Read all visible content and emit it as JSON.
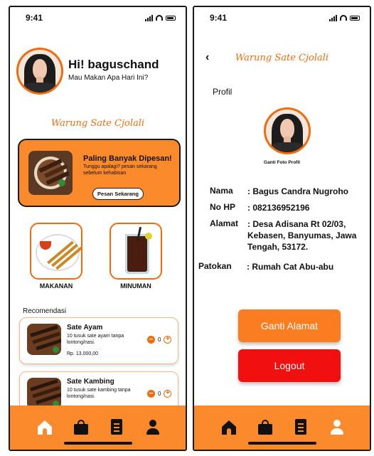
{
  "status_bar": {
    "time": "9:41"
  },
  "home": {
    "greeting_title": "Hi! baguschand",
    "greeting_subtitle": "Mau Makan Apa Hari Ini?",
    "brand": "Warung Sate Cjolali",
    "promo": {
      "title": "Paling Banyak Dipesan!",
      "description": "Tunggu apalagi? pesan sekarang sebelum kehabisan",
      "button": "Pesan Sekarang"
    },
    "categories": [
      {
        "label": "MAKANAN",
        "icon": "satay-food-image"
      },
      {
        "label": "MINUMAN",
        "icon": "iced-drink-image"
      }
    ],
    "recommendation_title": "Recomendasi",
    "items": [
      {
        "name": "Sate Ayam",
        "description": "10 tusuk sate ayam tanpa lontong/nasi.",
        "price": "Rp. 13.000,00",
        "qty": "0"
      },
      {
        "name": "Sate Kambing",
        "description": "10 tusuk sate kambing tanpa lontong/nasi.",
        "price": "",
        "qty": "0"
      }
    ]
  },
  "profile": {
    "back": "‹",
    "brand": "Warung Sate Cjolali",
    "section_title": "Profil",
    "change_photo": "Ganti Foto Profil",
    "fields": {
      "nama": {
        "label": "Nama",
        "value": ": Bagus Candra Nugroho"
      },
      "nohp": {
        "label": "No HP",
        "value": ": 082136952196"
      },
      "alamat": {
        "label": "Alamat",
        "value": ": Desa Adisana Rt 02/03, Kebasen, Banyumas, Jawa Tengah, 53172."
      },
      "patokan": {
        "label": "Patokan",
        "value": ": Rumah Cat Abu-abu"
      }
    },
    "buttons": {
      "change_address": "Ganti Alamat",
      "logout": "Logout"
    }
  },
  "tabbar": {
    "icons": [
      "home-icon",
      "shopping-bag-icon",
      "orders-icon",
      "profile-icon"
    ]
  },
  "colors": {
    "accent": "#fb8a2c",
    "border_orange": "#f06c0f",
    "logout_red": "#f20f0f"
  }
}
